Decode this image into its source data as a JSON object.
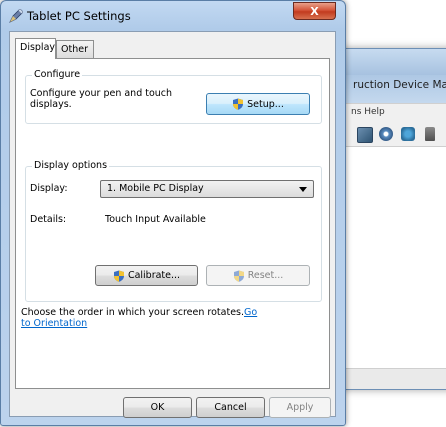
{
  "background_window": {
    "title": "ruction Device Mana",
    "menu": "ns  Help"
  },
  "dialog": {
    "title": "Tablet PC Settings",
    "close_label": "X"
  },
  "tabs": [
    {
      "label": "Display",
      "active": true
    },
    {
      "label": "Other",
      "active": false
    }
  ],
  "configure": {
    "group_label": "Configure",
    "description_line1": "Configure your pen and touch",
    "description_line2": "displays.",
    "setup_label": "Setup..."
  },
  "display_options": {
    "group_label": "Display options",
    "display_label": "Display:",
    "display_value": "1. Mobile PC Display",
    "details_label": "Details:",
    "details_value": "Touch Input Available",
    "calibrate_label": "Calibrate...",
    "reset_label": "Reset..."
  },
  "orientation": {
    "text": "Choose the order in which your screen rotates.",
    "link_part1": "Go",
    "link_part2": "to Orientation"
  },
  "footer": {
    "ok_label": "OK",
    "cancel_label": "Cancel",
    "apply_label": "Apply"
  },
  "colors": {
    "link": "#0066cc",
    "close_button": "#c23b1f",
    "title_bar": "#b0cbe9"
  }
}
